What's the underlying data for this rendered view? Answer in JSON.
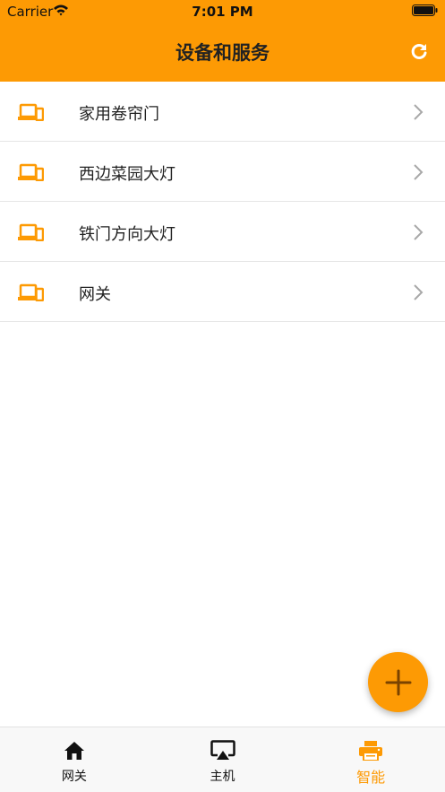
{
  "status_bar": {
    "carrier": "Carrier",
    "time": "7:01 PM"
  },
  "nav": {
    "title": "设备和服务",
    "refresh_icon": "refresh-icon"
  },
  "devices": [
    {
      "label": "家用卷帘门",
      "icon": "device-icon"
    },
    {
      "label": "西边菜园大灯",
      "icon": "device-icon"
    },
    {
      "label": "铁门方向大灯",
      "icon": "device-icon"
    },
    {
      "label": "网关",
      "icon": "device-icon"
    }
  ],
  "fab": {
    "icon": "plus-icon"
  },
  "tabs": [
    {
      "label": "网关",
      "icon": "home-icon",
      "active": false
    },
    {
      "label": "主机",
      "icon": "airplay-icon",
      "active": false
    },
    {
      "label": "智能",
      "icon": "printer-icon",
      "active": true
    }
  ],
  "colors": {
    "accent": "#fd9a04",
    "text": "#222222",
    "divider": "#e6e6e6",
    "tab_bar_bg": "#f8f8f8"
  }
}
